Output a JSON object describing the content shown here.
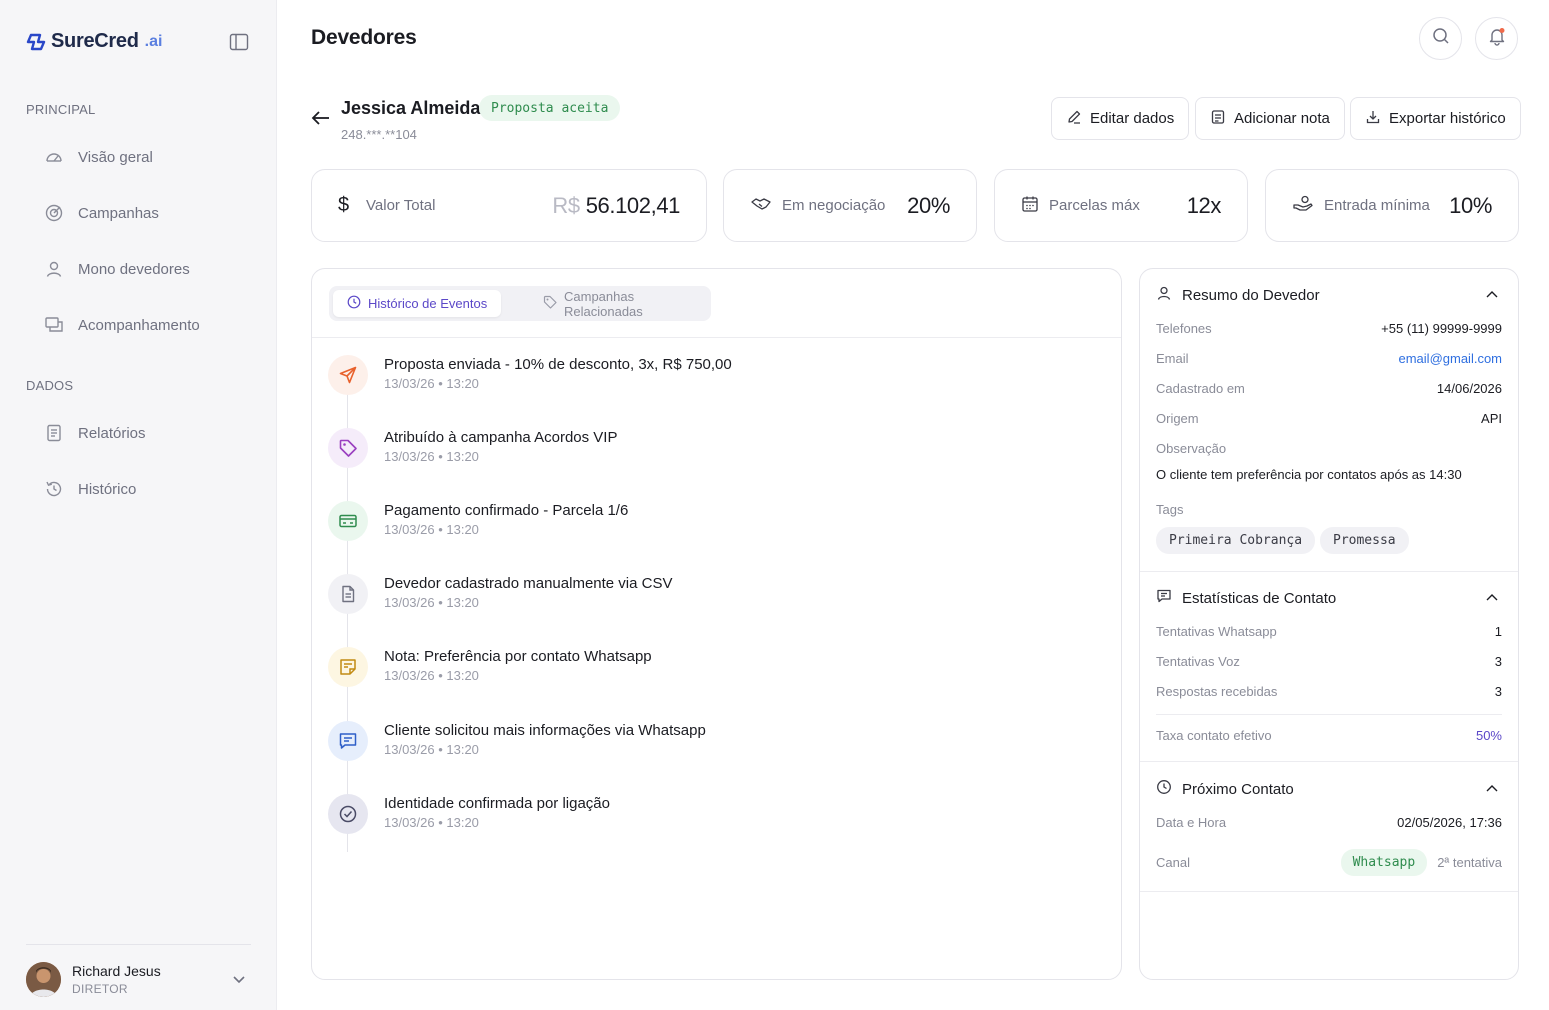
{
  "app": {
    "brand": "SureCred",
    "brand_suffix": ".ai",
    "page_title": "Devedores"
  },
  "sidebar": {
    "section_principal": "PRINCIPAL",
    "section_dados": "DADOS",
    "items": [
      {
        "label": "Visão geral",
        "icon": "gauge-icon"
      },
      {
        "label": "Campanhas",
        "icon": "target-icon"
      },
      {
        "label": "Mono devedores",
        "icon": "user-icon"
      },
      {
        "label": "Acompanhamento",
        "icon": "chat-icon"
      },
      {
        "label": "Relatórios",
        "icon": "report-icon"
      },
      {
        "label": "Histórico",
        "icon": "history-icon"
      }
    ],
    "user": {
      "name": "Richard Jesus",
      "role": "DIRETOR"
    }
  },
  "debtor": {
    "name": "Jessica Almeida",
    "status": "Proposta aceita",
    "document": "248.***.**104"
  },
  "actions": {
    "edit": "Editar dados",
    "add_note": "Adicionar nota",
    "export": "Exportar histórico"
  },
  "stats": {
    "total_label": "Valor Total",
    "total_currency": "R$",
    "total_value": "56.102,41",
    "negotiation_label": "Em negociação",
    "negotiation_value": "20%",
    "installments_label": "Parcelas máx",
    "installments_value": "12x",
    "entry_label": "Entrada mínima",
    "entry_value": "10%"
  },
  "tabs": {
    "events": "Histórico de Eventos",
    "campaigns": "Campanhas Relacionadas"
  },
  "events": [
    {
      "title": "Proposta enviada - 10% de desconto, 3x, R$ 750,00",
      "time": "13/03/26 • 13:20",
      "icon": "send-icon",
      "color": "#e8612c",
      "bg": "#fdf0ea"
    },
    {
      "title": "Atribuído à campanha Acordos VIP",
      "time": "13/03/26 • 13:20",
      "icon": "tag-icon",
      "color": "#9a3fc0",
      "bg": "#f5ecfa"
    },
    {
      "title": "Pagamento confirmado - Parcela 1/6",
      "time": "13/03/26 • 13:20",
      "icon": "card-icon",
      "color": "#2f8c4e",
      "bg": "#eaf7ee"
    },
    {
      "title": "Devedor cadastrado manualmente via CSV",
      "time": "13/03/26 • 13:20",
      "icon": "document-icon",
      "color": "#6f7180",
      "bg": "#f1f1f5"
    },
    {
      "title": "Nota: Preferência por contato Whatsapp",
      "time": "13/03/26 • 13:20",
      "icon": "note-icon",
      "color": "#c28a12",
      "bg": "#fdf6e2"
    },
    {
      "title": "Cliente solicitou mais informações via Whatsapp",
      "time": "13/03/26 • 13:20",
      "icon": "message-icon",
      "color": "#2f5fc8",
      "bg": "#e6eefc"
    },
    {
      "title": "Identidade confirmada por ligação",
      "time": "13/03/26 • 13:20",
      "icon": "check-circle-icon",
      "color": "#4a4b66",
      "bg": "#e6e6f0"
    }
  ],
  "summary": {
    "title": "Resumo do Devedor",
    "phone_label": "Telefones",
    "phone": "+55 (11) 99999-9999",
    "email_label": "Email",
    "email": "email@gmail.com",
    "registered_label": "Cadastrado em",
    "registered": "14/06/2026",
    "origin_label": "Origem",
    "origin": "API",
    "note_label": "Observação",
    "note": "O cliente tem preferência por contatos após as 14:30",
    "tags_label": "Tags",
    "tags": [
      "Primeira Cobrança",
      "Promessa"
    ]
  },
  "contact_stats": {
    "title": "Estatísticas de Contato",
    "whatsapp_label": "Tentativas Whatsapp",
    "whatsapp": "1",
    "voice_label": "Tentativas Voz",
    "voice": "3",
    "responses_label": "Respostas recebidas",
    "responses": "3",
    "rate_label": "Taxa contato efetivo",
    "rate": "50%"
  },
  "next_contact": {
    "title": "Próximo Contato",
    "datetime_label": "Data e Hora",
    "datetime": "02/05/2026, 17:36",
    "channel_label": "Canal",
    "channel": "Whatsapp",
    "attempt": "2ª tentativa"
  },
  "colors": {
    "accent": "#5b48c8",
    "link": "#2f6fe0",
    "success": "#2f8c4e",
    "success_bg": "#eaf7ee",
    "notification_dot": "#f06a4a"
  }
}
